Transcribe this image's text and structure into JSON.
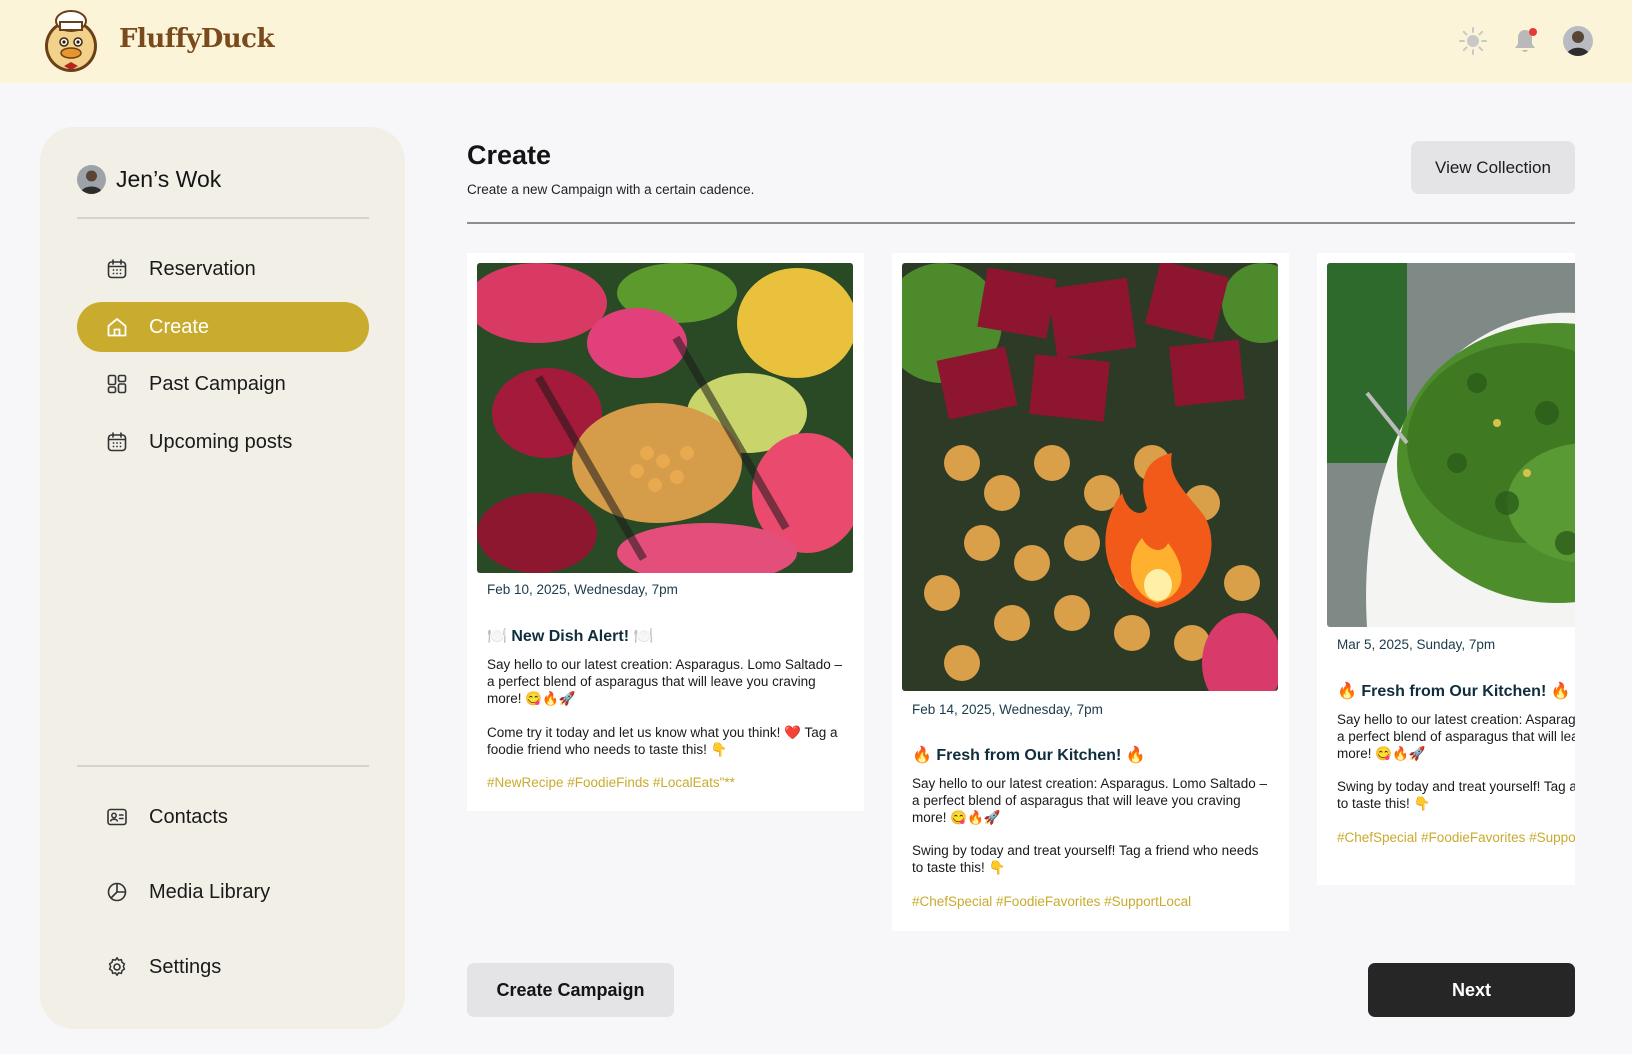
{
  "brand": {
    "name": "FluffyDuck"
  },
  "topbar": {
    "icons": [
      "sun-icon",
      "bell-icon",
      "user-avatar"
    ],
    "notification_dot_color": "#e53935"
  },
  "sidebar": {
    "workspace": "Jen’s Wok",
    "items": [
      {
        "label": "Reservation",
        "icon": "calendar-icon"
      },
      {
        "label": "Create",
        "icon": "home-icon",
        "active": true
      },
      {
        "label": "Past Campaign",
        "icon": "grid-icon"
      },
      {
        "label": "Upcoming posts",
        "icon": "calendar-icon"
      }
    ],
    "bottom_items": [
      {
        "label": "Contacts",
        "icon": "contact-card-icon"
      },
      {
        "label": "Media Library",
        "icon": "media-icon"
      },
      {
        "label": "Settings",
        "icon": "gear-icon"
      }
    ]
  },
  "main": {
    "title": "Create",
    "subtitle": "Create a new Campaign with a certain cadence.",
    "view_collection": "View Collection"
  },
  "cards": [
    {
      "date": "Feb 10, 2025, Wednesday, 7pm",
      "title": "🍽️ New Dish Alert! 🍽️",
      "body1": "Say hello to our latest creation: Asparagus. Lomo Saltado – a perfect blend of asparagus that will leave you craving more! 😋🔥🚀",
      "body2": "Come try it today and let us know what you think! ❤️ Tag a foodie friend who needs to taste this! 👇",
      "tags": "#NewRecipe #FoodieFinds #LocalEats\"**"
    },
    {
      "date": "Feb 14, 2025, Wednesday, 7pm",
      "title": "🔥 Fresh from Our Kitchen! 🔥",
      "body1": "Say hello to our latest creation: Asparagus. Lomo Saltado – a perfect blend of asparagus that will leave you craving more! 😋🔥🚀",
      "body2": "Swing by today and treat yourself! Tag a friend who needs to taste this! 👇",
      "tags": "#ChefSpecial #FoodieFavorites #SupportLocal"
    },
    {
      "date": "Mar 5, 2025, Sunday, 7pm",
      "title": "🔥 Fresh from Our Kitchen! 🔥",
      "body1": "Say hello to our latest creation: Asparagus. Lomo Saltado – a perfect blend of asparagus that will leave you craving more! 😋🔥🚀",
      "body2": "Swing by today and treat yourself! Tag a friend who needs to taste this! 👇",
      "tags": "#ChefSpecial #FoodieFavorites #SupportLocal"
    }
  ],
  "actions": {
    "create_campaign": "Create Campaign",
    "next": "Next"
  },
  "colors": {
    "accent": "#c9ab2e",
    "topbar": "#fbf4d9",
    "sidebar": "#f1efe6",
    "next_button": "#262626"
  }
}
